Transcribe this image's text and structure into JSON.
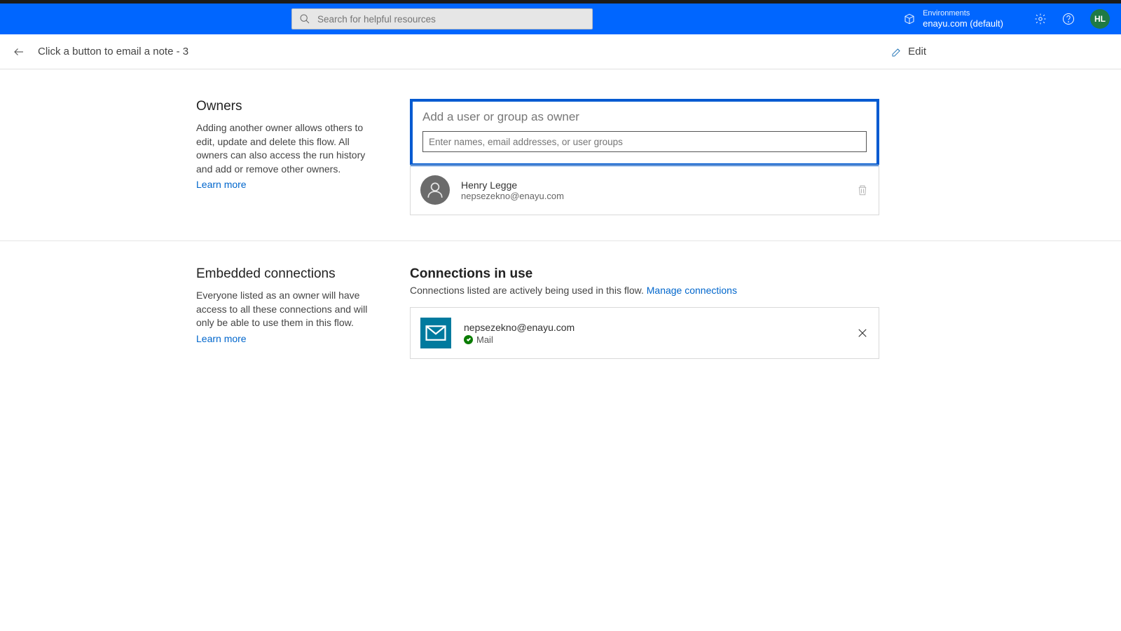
{
  "header": {
    "search_placeholder": "Search for helpful resources",
    "env_label": "Environments",
    "env_value": "enayu.com (default)",
    "avatar_initials": "HL"
  },
  "subheader": {
    "title": "Click a button to email a note - 3",
    "edit_label": "Edit"
  },
  "owners": {
    "heading": "Owners",
    "description": "Adding another owner allows others to edit, update and delete this flow. All owners can also access the run history and add or remove other owners.",
    "learn_more": "Learn more",
    "add_title": "Add a user or group as owner",
    "add_placeholder": "Enter names, email addresses, or user groups",
    "list": [
      {
        "name": "Henry Legge",
        "email": "nepsezekno@enayu.com"
      }
    ]
  },
  "connections": {
    "heading": "Embedded connections",
    "description": "Everyone listed as an owner will have access to all these connections and will only be able to use them in this flow.",
    "learn_more": "Learn more",
    "right_heading": "Connections in use",
    "right_desc_prefix": "Connections listed are actively being used in this flow. ",
    "manage_link": "Manage connections",
    "list": [
      {
        "email": "nepsezekno@enayu.com",
        "type": "Mail"
      }
    ]
  }
}
